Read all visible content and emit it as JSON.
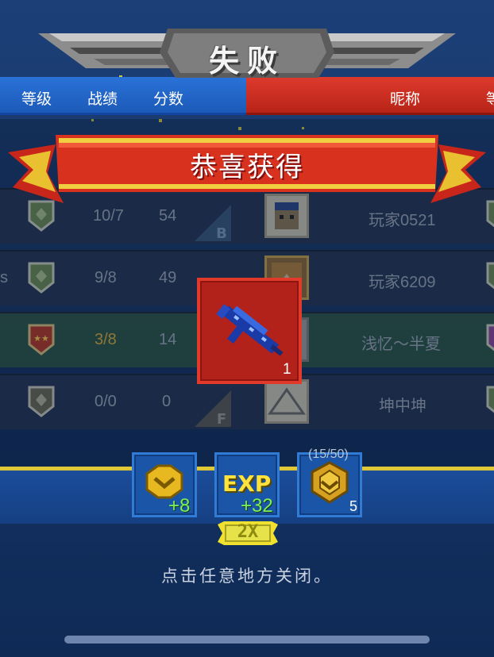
{
  "banner": {
    "result_title": "失败"
  },
  "table_header": {
    "level": "等级",
    "record": "战绩",
    "score": "分数",
    "nickname": "昵称",
    "right_cut": "等"
  },
  "rows": [
    {
      "record": "10/7",
      "score": "54",
      "name": "玩家0521",
      "grade": "B",
      "left_cut": ""
    },
    {
      "record": "9/8",
      "score": "49",
      "name": "玩家6209",
      "grade": "",
      "left_cut": "s"
    },
    {
      "record": "3/8",
      "score": "14",
      "name": "浅忆～半夏",
      "grade": "",
      "left_cut": ""
    },
    {
      "record": "0/0",
      "score": "0",
      "name": "坤中坤",
      "grade": "F",
      "left_cut": ""
    }
  ],
  "reward_popup": {
    "title": "恭喜获得",
    "item": {
      "icon": "blue-rifle-icon",
      "count": "1"
    }
  },
  "rewards": {
    "coins": "+8",
    "exp_label": "EXP",
    "exp": "+32",
    "rank_progress": "(15/50)",
    "rank_level": "5",
    "multiplier": "2X"
  },
  "hint": "点击任意地方关闭。",
  "colors": {
    "header_blue": "#2a72d8",
    "header_red": "#dd3a2c",
    "ribbon_red": "#e23a2a",
    "gold": "#e0c836",
    "exp_yellow": "#ffe23c",
    "bonus_green": "#7cf05a"
  }
}
